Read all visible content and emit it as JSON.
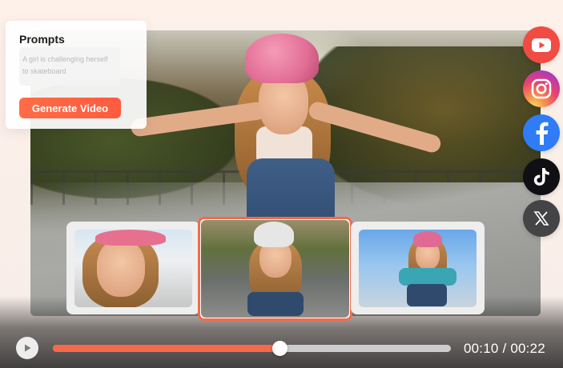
{
  "prompts": {
    "title": "Prompts",
    "prompt_text": "A girl is challenging herself to skateboard",
    "generate_button": "Generate Video"
  },
  "social_icons": [
    "youtube-icon",
    "instagram-icon",
    "facebook-icon",
    "tiktok-icon",
    "x-icon"
  ],
  "player": {
    "current_time": "00:10",
    "separator": " / ",
    "total_time": "00:22",
    "progress_fraction": 0.57
  },
  "colors": {
    "accent": "#f6694b",
    "youtube": "#f04c43",
    "facebook": "#2f7cf6",
    "tiktok": "#0f0f14",
    "x": "#444446"
  }
}
